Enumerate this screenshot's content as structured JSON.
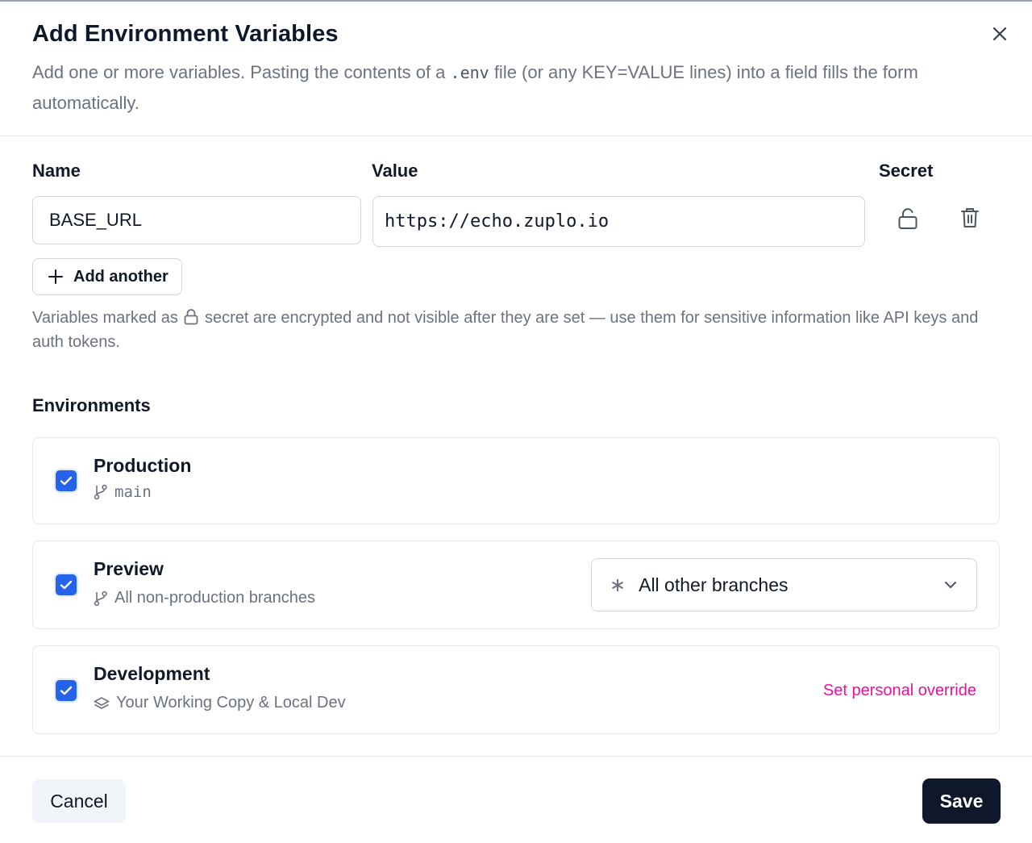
{
  "dialog": {
    "title": "Add Environment Variables",
    "description_prefix": "Add one or more variables. Pasting the contents of a ",
    "description_code": ".env",
    "description_suffix": " file (or any KEY=VALUE lines) into a field fills the form automatically."
  },
  "form": {
    "name_label": "Name",
    "value_label": "Value",
    "secret_label": "Secret",
    "rows": [
      {
        "name": "BASE_URL",
        "value": "https://echo.zuplo.io",
        "secret": false
      }
    ],
    "add_another_label": "Add another",
    "hint_prefix": "Variables marked as ",
    "hint_suffix": " secret are encrypted and not visible after they are set — use them for sensitive information like API keys and auth tokens."
  },
  "environments": {
    "heading": "Environments",
    "items": [
      {
        "title": "Production",
        "subtitle": "main",
        "checked": true
      },
      {
        "title": "Preview",
        "subtitle": "All non-production branches",
        "checked": true,
        "branch_select": "All other branches"
      },
      {
        "title": "Development",
        "subtitle": "Your Working Copy & Local Dev",
        "checked": true,
        "override_label": "Set personal override"
      }
    ]
  },
  "footer": {
    "cancel_label": "Cancel",
    "save_label": "Save"
  },
  "colors": {
    "accent": "#2563eb",
    "primary_button": "#0f172a",
    "link": "#e5139c"
  },
  "icons": {
    "close": "close-icon",
    "secret_toggle": "unlock-icon",
    "delete": "trash-icon",
    "add": "plus-icon",
    "branch": "git-branch-icon",
    "layers": "layers-icon",
    "chevron": "chevron-down-icon",
    "checkbox": "check-icon"
  }
}
